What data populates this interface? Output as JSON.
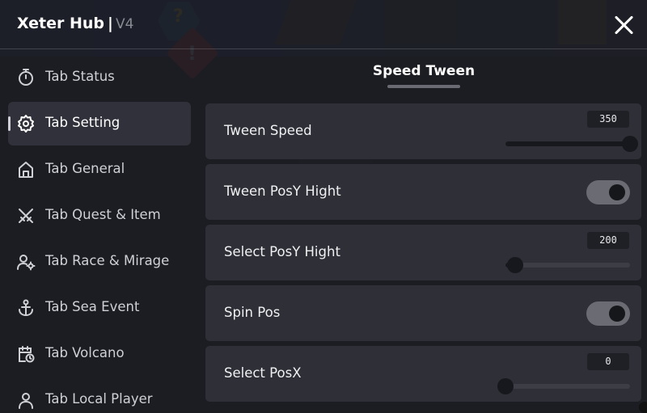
{
  "header": {
    "title": "Xeter Hub",
    "separator": "|",
    "version": "V4",
    "close_icon": "close-icon"
  },
  "sidebar": {
    "items": [
      {
        "label": "Tab Status",
        "icon": "stopwatch-icon",
        "active": false
      },
      {
        "label": "Tab Setting",
        "icon": "gear-icon",
        "active": true
      },
      {
        "label": "Tab General",
        "icon": "home-icon",
        "active": false
      },
      {
        "label": "Tab Quest & Item",
        "icon": "crossed-swords-icon",
        "active": false
      },
      {
        "label": "Tab Race & Mirage",
        "icon": "user-settings-icon",
        "active": false
      },
      {
        "label": "Tab Sea Event",
        "icon": "anchor-icon",
        "active": false
      },
      {
        "label": "Tab Volcano",
        "icon": "calendar-clock-icon",
        "active": false
      },
      {
        "label": "Tab Local Player",
        "icon": "person-icon",
        "active": false
      }
    ]
  },
  "section": {
    "title": "Speed Tween"
  },
  "settings": [
    {
      "type": "slider",
      "label": "Tween Speed",
      "value": "350",
      "fraction": 1.0
    },
    {
      "type": "toggle",
      "label": "Tween PosY Hight",
      "on": true
    },
    {
      "type": "slider",
      "label": "Select PosY Hight",
      "value": "200",
      "fraction": 0.08
    },
    {
      "type": "toggle",
      "label": "Spin Pos",
      "on": true
    },
    {
      "type": "slider",
      "label": "Select PosX",
      "value": "0",
      "fraction": 0.0
    }
  ],
  "colors": {
    "panel": "#1c1d22",
    "row": "#2e2f37",
    "accent": "#ffffff",
    "toggle_track": "#6a6b73"
  }
}
